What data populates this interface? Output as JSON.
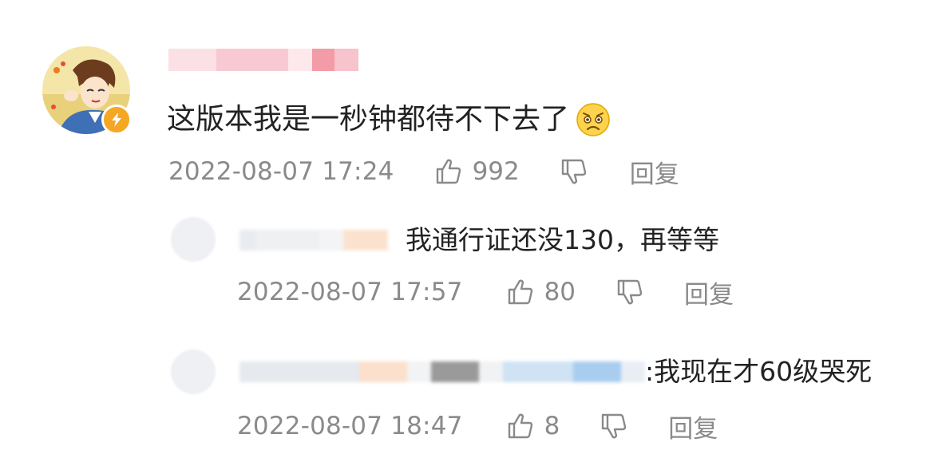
{
  "comment": {
    "text": "这版本我是一秒钟都待不下去了",
    "emoji_icon": "worried-face-icon",
    "time": "2022-08-07 17:24",
    "likes": "992",
    "reply_label": "回复"
  },
  "replies": [
    {
      "text": "我通行证还没130，再等等",
      "time": "2022-08-07 17:57",
      "likes": "80",
      "reply_label": "回复"
    },
    {
      "text": ":我现在才60级哭死",
      "time": "2022-08-07 18:47",
      "likes": "8",
      "reply_label": "回复"
    }
  ],
  "colors": {
    "text": "#222222",
    "meta": "#8a8a8a",
    "badge": "#f5a623",
    "background": "#ffffff"
  }
}
